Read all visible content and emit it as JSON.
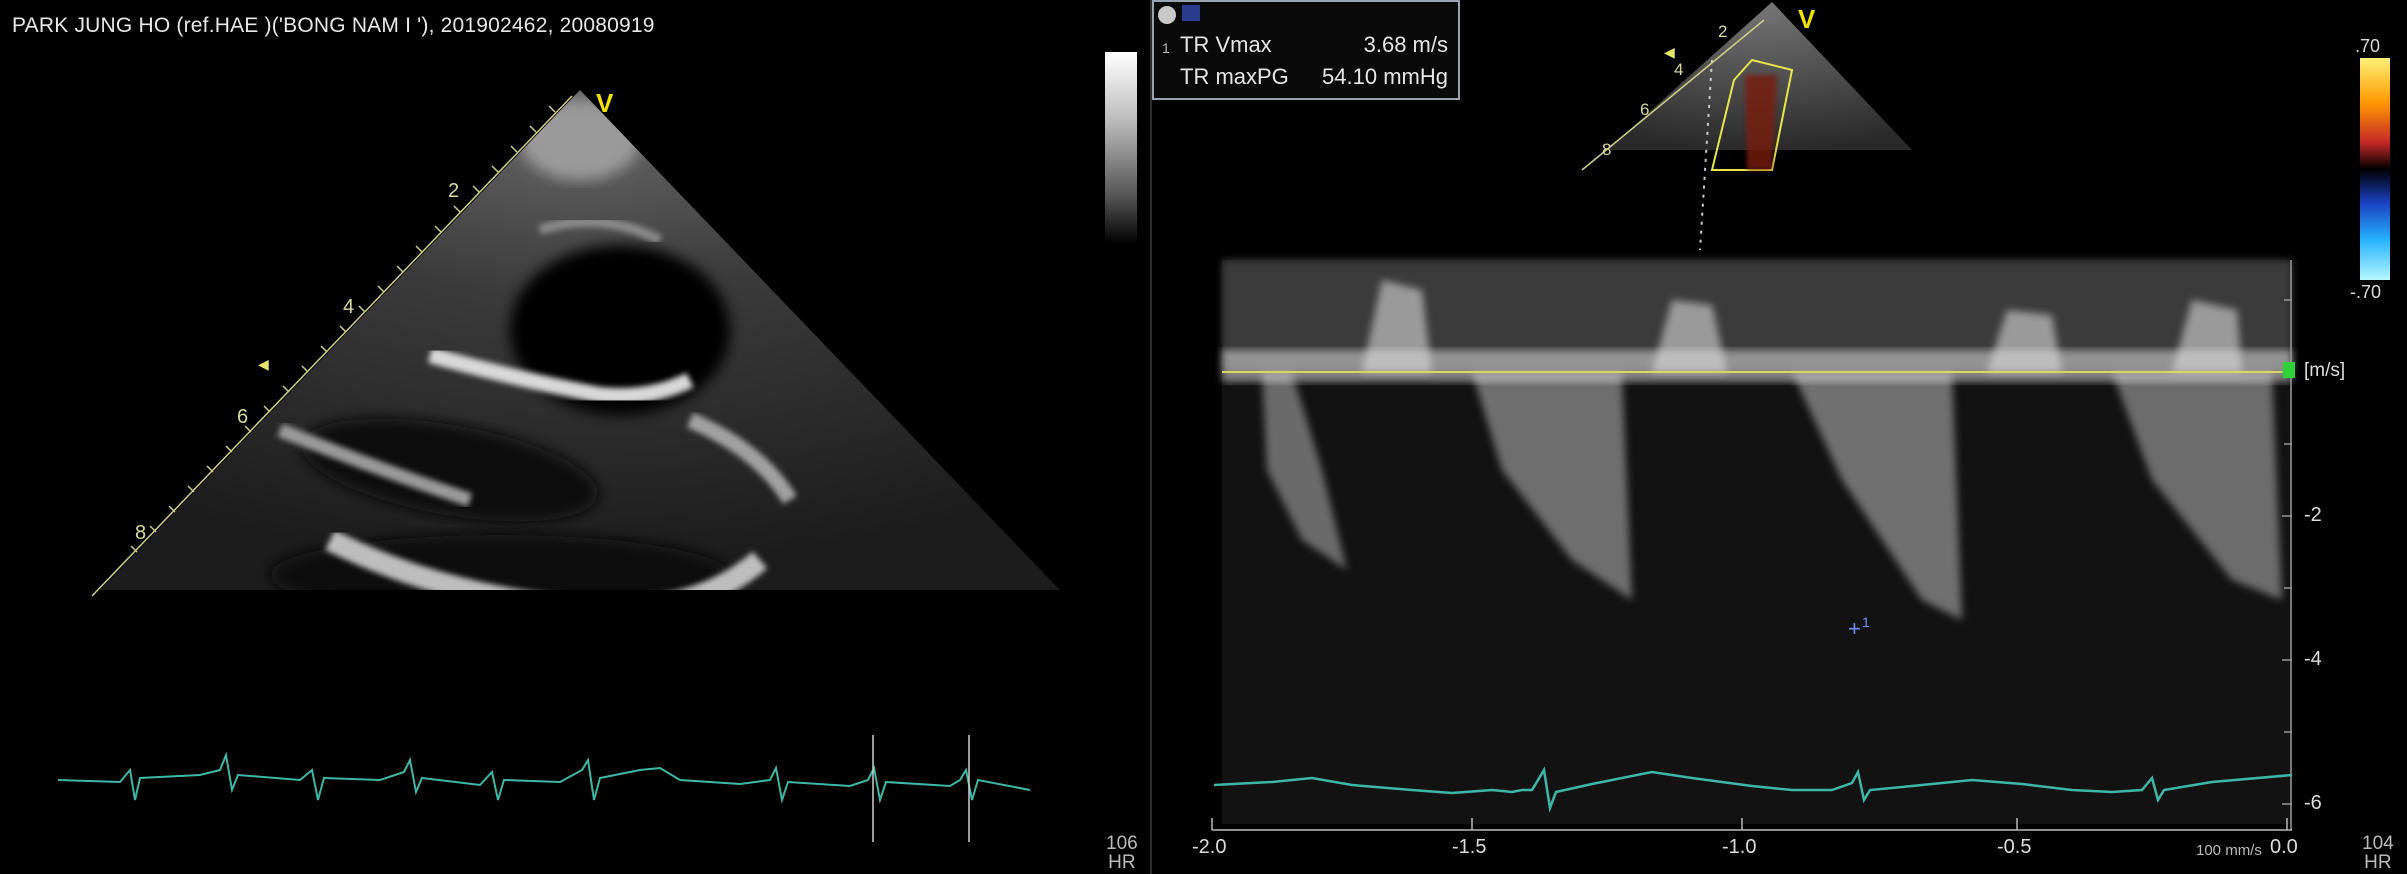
{
  "patient_header": "PARK JUNG HO  (ref.HAE )('BONG NAM I '), 201902462, 20080919",
  "left_view": {
    "depth_labels": [
      "2",
      "4",
      "6",
      "8"
    ],
    "orientation_marker": "V",
    "heart_rate": "106",
    "heart_rate_unit": "HR"
  },
  "right_view": {
    "measurements": [
      {
        "label": "TR Vmax",
        "value": "3.68 m/s"
      },
      {
        "label": "TR maxPG",
        "value": "54.10 mmHg"
      }
    ],
    "measurement_index": "1",
    "color_scale": {
      "top": ".70",
      "bottom": "-.70"
    },
    "preview_depth_labels": [
      "2",
      "4",
      "6",
      "8"
    ],
    "orientation_marker": "V",
    "velocity_unit": "[m/s]",
    "velocity_ticks": [
      "-2",
      "-4",
      "-6"
    ],
    "time_ticks": [
      "-2.0",
      "-1.5",
      "-1.0",
      "-0.5",
      "0.0"
    ],
    "sweep_speed": "100 mm/s",
    "cursor_label": "1",
    "heart_rate": "104",
    "heart_rate_unit": "HR"
  },
  "colors": {
    "ecg": "#3fb7a6",
    "baseline": "#d8d860",
    "accent_yellow": "#f2e200",
    "baseline_marker": "#2ed33a"
  }
}
